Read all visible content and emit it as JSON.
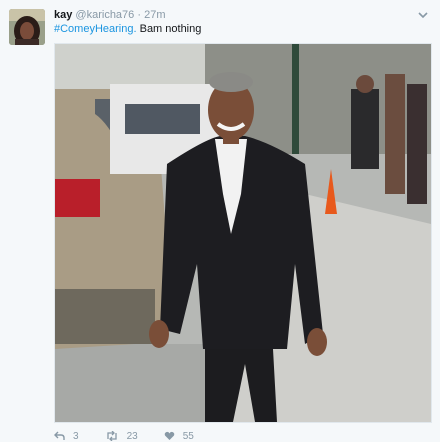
{
  "tweet": {
    "name": "kay",
    "handle": "@karicha76",
    "separator": "·",
    "time": "27m",
    "hashtag": "#ComeyHearing.",
    "body": " Bam nothing",
    "photo_description_icon": "photo",
    "actions": {
      "reply_count": "3",
      "retweet_count": "23",
      "like_count": "55"
    }
  },
  "icons": {
    "reply": "reply-icon",
    "retweet": "retweet-icon",
    "like": "heart-icon",
    "caret": "chevron-down-icon"
  },
  "colors": {
    "accent": "#1b95e0",
    "muted": "#8899a6",
    "background": "#f5f8fa"
  }
}
